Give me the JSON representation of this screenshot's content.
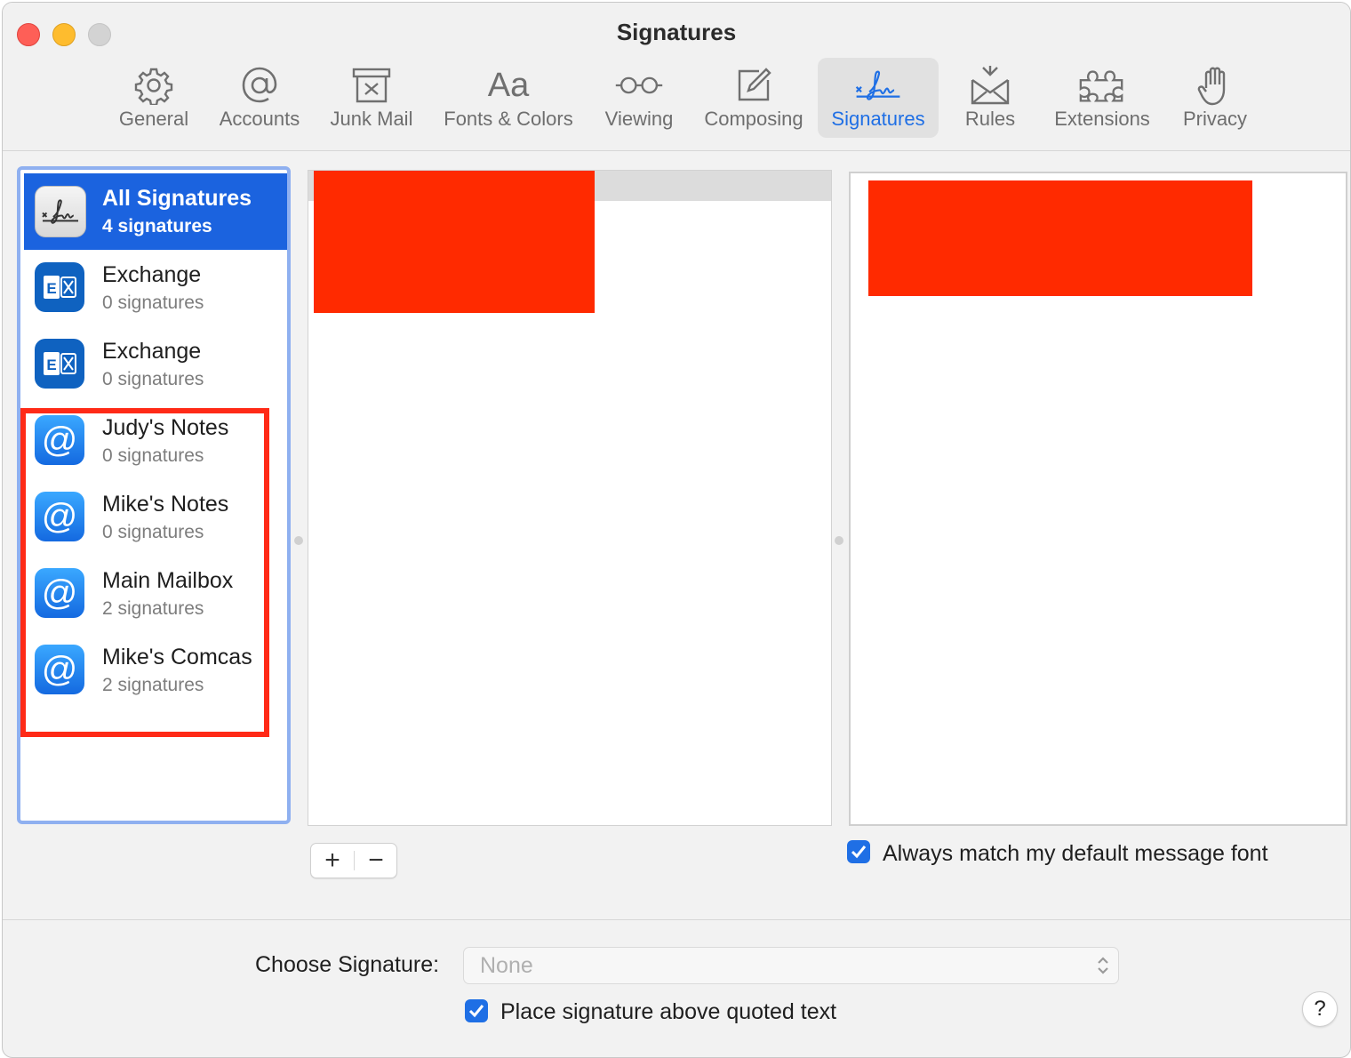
{
  "window": {
    "title": "Signatures"
  },
  "toolbar": {
    "tabs": [
      {
        "label": "General",
        "icon": "gear-icon"
      },
      {
        "label": "Accounts",
        "icon": "at-icon"
      },
      {
        "label": "Junk Mail",
        "icon": "junk-mail-icon"
      },
      {
        "label": "Fonts & Colors",
        "icon": "fonts-icon",
        "icon_text": "Aa"
      },
      {
        "label": "Viewing",
        "icon": "glasses-icon"
      },
      {
        "label": "Composing",
        "icon": "compose-icon"
      },
      {
        "label": "Signatures",
        "icon": "signature-icon",
        "selected": true
      },
      {
        "label": "Rules",
        "icon": "rules-icon"
      },
      {
        "label": "Extensions",
        "icon": "puzzle-icon"
      },
      {
        "label": "Privacy",
        "icon": "hand-icon"
      }
    ]
  },
  "accounts": [
    {
      "name": "All Signatures",
      "count": "4 signatures",
      "icon": "signature-icon",
      "selected": true
    },
    {
      "name": "Exchange",
      "count": "0 signatures",
      "icon": "exchange-icon"
    },
    {
      "name": "Exchange",
      "count": "0 signatures",
      "icon": "exchange-icon"
    },
    {
      "name": "Judy's Notes",
      "count": "0 signatures",
      "icon": "at-mail-icon"
    },
    {
      "name": "Mike's Notes",
      "count": "0 signatures",
      "icon": "at-mail-icon"
    },
    {
      "name": "Main Mailbox",
      "count": "2 signatures",
      "icon": "at-mail-icon"
    },
    {
      "name": "Mike's Comcas",
      "count": "2 signatures",
      "icon": "at-mail-icon"
    }
  ],
  "signature_list": {
    "add_label": "+",
    "remove_label": "−"
  },
  "preview": {
    "match_font_label": "Always match my default message font",
    "match_font_checked": true
  },
  "footer": {
    "choose_label": "Choose Signature:",
    "choose_value": "None",
    "place_above_label": "Place signature above quoted text",
    "place_above_checked": true,
    "help_label": "?"
  },
  "colors": {
    "accent": "#1f6fe5",
    "selection": "#1b63df",
    "highlight": "#ff2a17",
    "redaction": "#ff2a00"
  }
}
